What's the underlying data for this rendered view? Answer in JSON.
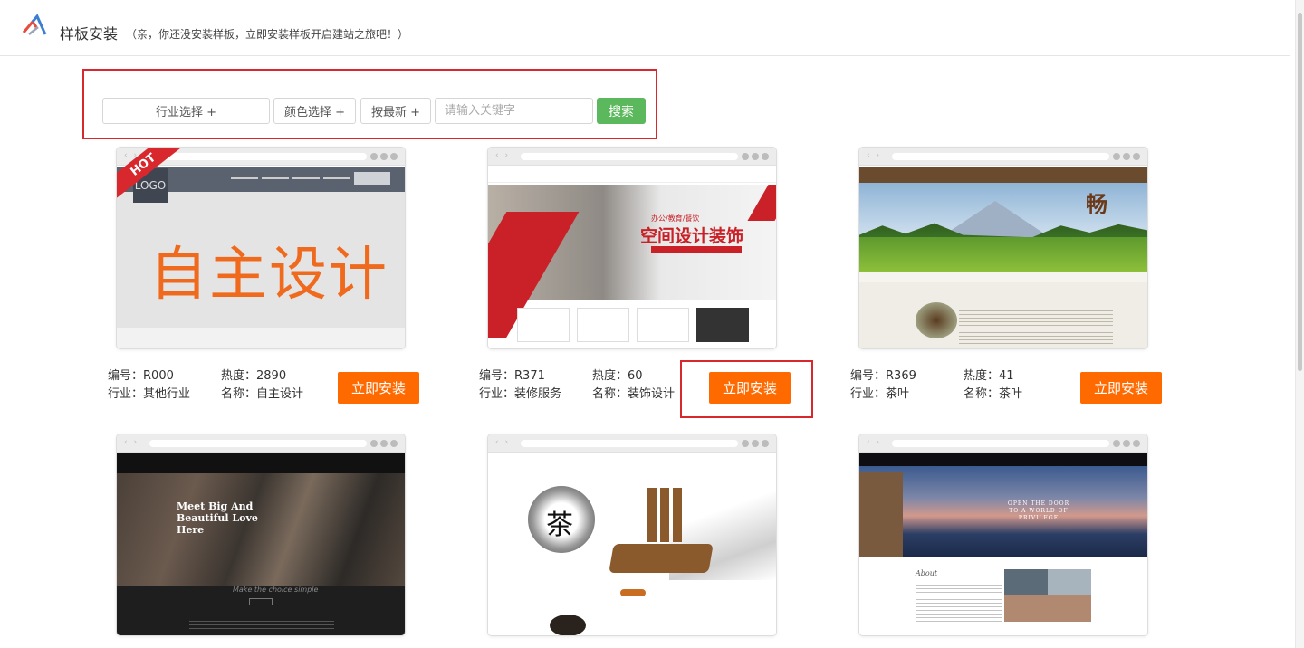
{
  "header": {
    "title": "样板安装",
    "subtitle": "（亲，你还没安装样板，立即安装样板开启建站之旅吧！）"
  },
  "filters": {
    "industry": "行业选择 +",
    "color": "颜色选择 +",
    "newest": "按最新 +",
    "search_placeholder": "请输入关键字",
    "search_button": "搜索"
  },
  "labels": {
    "id": "编号：",
    "heat": "热度：",
    "industry": "行业：",
    "name": "名称：",
    "install": "立即安装"
  },
  "templates": [
    {
      "id": "R000",
      "heat": "2890",
      "industry": "其他行业",
      "name": "自主设计",
      "badge": "HOT",
      "preview_logo": "LOGO",
      "preview_text": "自主设计"
    },
    {
      "id": "R371",
      "heat": "60",
      "industry": "装修服务",
      "name": "装饰设计",
      "preview_tagline": "办公/教育/餐饮",
      "preview_headline": "空间设计装饰"
    },
    {
      "id": "R369",
      "heat": "41",
      "industry": "茶叶",
      "name": "茶叶",
      "preview_glyph": "畅"
    },
    {
      "preview_headline": "Meet Big And Beautiful Love Here",
      "preview_sub": "Make the choice simple"
    },
    {
      "preview_glyph": "茶"
    },
    {
      "preview_motto": "OPEN THE DOOR TO A WORLD OF PRIVILEGE",
      "preview_about": "About"
    }
  ],
  "colors": {
    "accent_orange": "#ff6a00",
    "search_green": "#5cb85c",
    "highlight_red": "#d9272e"
  }
}
